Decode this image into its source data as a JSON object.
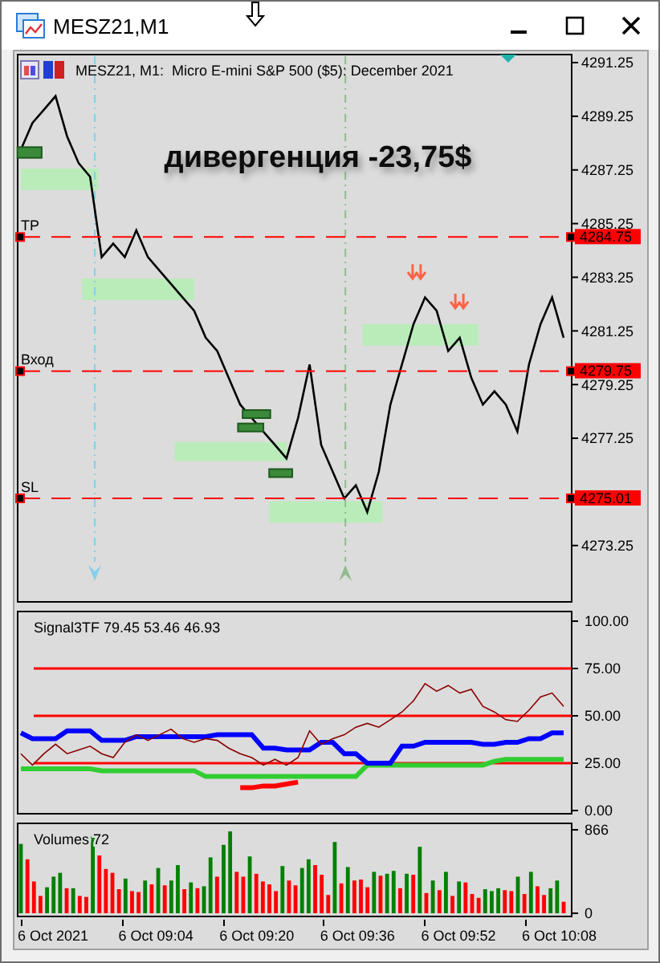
{
  "window": {
    "title": "MESZ21,M1"
  },
  "main_panel": {
    "title": "MESZ21, M1:  Micro E-mini S&P 500 ($5): December 2021",
    "overlay_text": "дивергенция -23,75$",
    "levels": [
      {
        "label": "TP",
        "price": "4284.75"
      },
      {
        "label": "Вход",
        "price": "4279.75"
      },
      {
        "label": "SL",
        "price": "4275.01"
      }
    ],
    "chart_data": {
      "type": "line",
      "ylim": [
        4271.15,
        4291.55
      ],
      "categories": [
        null,
        null,
        null,
        null,
        null,
        null,
        null,
        null,
        null,
        null,
        null,
        null,
        null,
        null,
        null,
        null,
        null,
        null,
        null,
        null,
        null,
        null,
        null,
        null,
        null,
        null,
        null,
        null,
        null,
        null,
        null,
        null,
        null,
        null,
        null,
        null,
        null,
        null,
        null,
        null,
        null,
        null,
        null,
        null,
        null,
        null,
        null,
        null
      ],
      "yticks": [
        4291.25,
        4289.25,
        4287.25,
        4285.25,
        4283.25,
        4281.25,
        4279.25,
        4277.25,
        4273.25
      ],
      "series": [
        {
          "color": "#000000",
          "values": [
            4288,
            4289,
            4289.5,
            4290,
            4288.5,
            4287.5,
            4287,
            4284,
            4284.5,
            4284,
            4285,
            4284,
            4283.5,
            4283,
            4282.5,
            4282,
            4281,
            4280.5,
            4279.5,
            4278.5,
            4278,
            4277.5,
            4277,
            4276.5,
            4278,
            4280,
            4277,
            4276,
            4275,
            4275.5,
            4274.5,
            4276,
            4278.5,
            4280,
            4281.5,
            4282.5,
            4282,
            4280.5,
            4281,
            4279.5,
            4278.5,
            4279,
            4278.5,
            4277.5,
            4280,
            4281.5,
            4282.5,
            4281
          ]
        }
      ]
    }
  },
  "indicator_panel": {
    "title": "Signal3TF 79.45 53.46 46.93",
    "chart_data": {
      "type": "line",
      "ylim": [
        -1.7,
        105.1
      ],
      "categories": [
        null,
        null,
        null,
        null,
        null,
        null,
        null,
        null,
        null,
        null,
        null,
        null,
        null,
        null,
        null,
        null,
        null,
        null,
        null,
        null,
        null,
        null,
        null,
        null,
        null,
        null,
        null,
        null,
        null,
        null,
        null,
        null,
        null,
        null,
        null,
        null,
        null,
        null,
        null,
        null,
        null,
        null,
        null,
        null,
        null,
        null,
        null,
        null
      ],
      "yticks": [
        {
          "value": 100,
          "label": "100.00"
        },
        {
          "value": 75,
          "label": "75.00"
        },
        {
          "value": 50,
          "label": "50.00"
        },
        {
          "value": 25,
          "label": "25.00"
        },
        {
          "value": 0,
          "label": "0.00"
        }
      ],
      "series": [
        {
          "color": "#8b0000",
          "values": [
            30,
            24,
            30,
            35,
            30,
            32,
            34,
            30,
            28,
            36,
            40,
            37,
            40,
            43,
            38,
            36,
            38,
            37,
            33,
            30,
            28,
            24,
            27,
            24,
            28,
            42,
            35,
            38,
            40,
            44,
            46,
            44,
            48,
            52,
            58,
            67,
            63,
            66,
            62,
            64,
            55,
            52,
            48,
            47,
            53,
            60,
            62,
            55
          ]
        },
        {
          "color": "#0000ff",
          "values": [
            41,
            38,
            38,
            38,
            42,
            42,
            42,
            37,
            37,
            37,
            39,
            39,
            39,
            39,
            39,
            39,
            39,
            40,
            40,
            40,
            40,
            33,
            33,
            32,
            32,
            32,
            36,
            36,
            30,
            30,
            25,
            25,
            25,
            34,
            34,
            36,
            36,
            36,
            36,
            36,
            35,
            35,
            36,
            36,
            38,
            38,
            41,
            41
          ]
        },
        {
          "color": "#32cd32",
          "values": [
            22,
            22,
            22,
            22,
            22,
            22,
            22,
            21,
            21,
            21,
            21,
            21,
            21,
            21,
            21,
            21,
            18,
            18,
            18,
            18,
            18,
            18,
            18,
            18,
            18,
            18,
            18,
            18,
            18,
            18,
            24,
            24,
            24,
            24,
            24,
            24,
            24,
            24,
            24,
            24,
            24,
            26,
            27,
            27,
            27,
            27,
            27,
            27
          ]
        },
        {
          "color": "#ff0000",
          "values": [
            null,
            null,
            null,
            null,
            null,
            null,
            null,
            null,
            null,
            null,
            null,
            null,
            null,
            null,
            null,
            null,
            null,
            null,
            null,
            12,
            12,
            13,
            13,
            14,
            15,
            null,
            null,
            null,
            null,
            null,
            null,
            null,
            null,
            null,
            null,
            null,
            null,
            null,
            null,
            null,
            null,
            null,
            null,
            null,
            null,
            null,
            null,
            null
          ]
        }
      ],
      "grid": true
    }
  },
  "volume_panel": {
    "title": "Volumes 72",
    "time_labels": [
      "6 Oct 2021",
      "6 Oct 09:04",
      "6 Oct 09:20",
      "6 Oct 09:36",
      "6 Oct 09:52",
      "6 Oct 10:08"
    ],
    "chart_data": {
      "type": "bar",
      "ylim": [
        -33,
        933
      ],
      "categories": [
        null,
        null,
        null,
        null,
        null,
        null,
        null,
        null,
        null,
        null,
        null,
        null,
        null,
        null,
        null,
        null,
        null,
        null,
        null,
        null,
        null,
        null,
        null,
        null,
        null,
        null,
        null,
        null,
        null,
        null,
        null,
        null,
        null,
        null,
        null,
        null,
        null,
        null,
        null,
        null,
        null,
        null,
        null,
        null,
        null,
        null,
        null,
        null,
        null,
        null,
        null,
        null,
        null,
        null,
        null,
        null,
        null,
        null,
        null,
        null,
        null,
        null,
        null,
        null,
        null,
        null,
        null,
        null,
        null,
        null,
        null,
        null,
        null,
        null,
        null,
        null,
        null,
        null,
        null,
        null,
        null,
        null,
        null,
        null
      ],
      "yticks": [
        866,
        0
      ],
      "stacked": true,
      "series": [
        {
          "color": "#008000",
          "values": [
            720,
            0,
            0,
            0,
            270,
            380,
            420,
            0,
            260,
            0,
            0,
            800,
            0,
            0,
            0,
            0,
            360,
            0,
            0,
            340,
            0,
            470,
            0,
            340,
            500,
            0,
            320,
            0,
            280,
            580,
            0,
            710,
            850,
            0,
            0,
            590,
            0,
            0,
            0,
            0,
            490,
            0,
            0,
            470,
            560,
            0,
            0,
            0,
            740,
            0,
            480,
            0,
            0,
            0,
            430,
            0,
            410,
            440,
            0,
            410,
            0,
            690,
            0,
            340,
            0,
            430,
            0,
            330,
            0,
            0,
            0,
            250,
            230,
            260,
            0,
            0,
            380,
            0,
            430,
            0,
            0,
            260,
            340,
            0
          ]
        },
        {
          "color": "#ff0000",
          "values": [
            0,
            560,
            330,
            180,
            0,
            0,
            0,
            260,
            0,
            180,
            170,
            0,
            600,
            460,
            420,
            250,
            0,
            230,
            220,
            0,
            300,
            0,
            290,
            0,
            0,
            250,
            0,
            260,
            0,
            0,
            380,
            0,
            0,
            430,
            380,
            0,
            410,
            330,
            300,
            230,
            0,
            340,
            290,
            0,
            0,
            500,
            400,
            190,
            0,
            310,
            0,
            340,
            350,
            270,
            0,
            390,
            0,
            0,
            260,
            0,
            400,
            0,
            210,
            0,
            240,
            0,
            180,
            0,
            320,
            200,
            160,
            0,
            0,
            0,
            240,
            230,
            0,
            200,
            0,
            280,
            190,
            0,
            0,
            120
          ]
        }
      ]
    }
  }
}
